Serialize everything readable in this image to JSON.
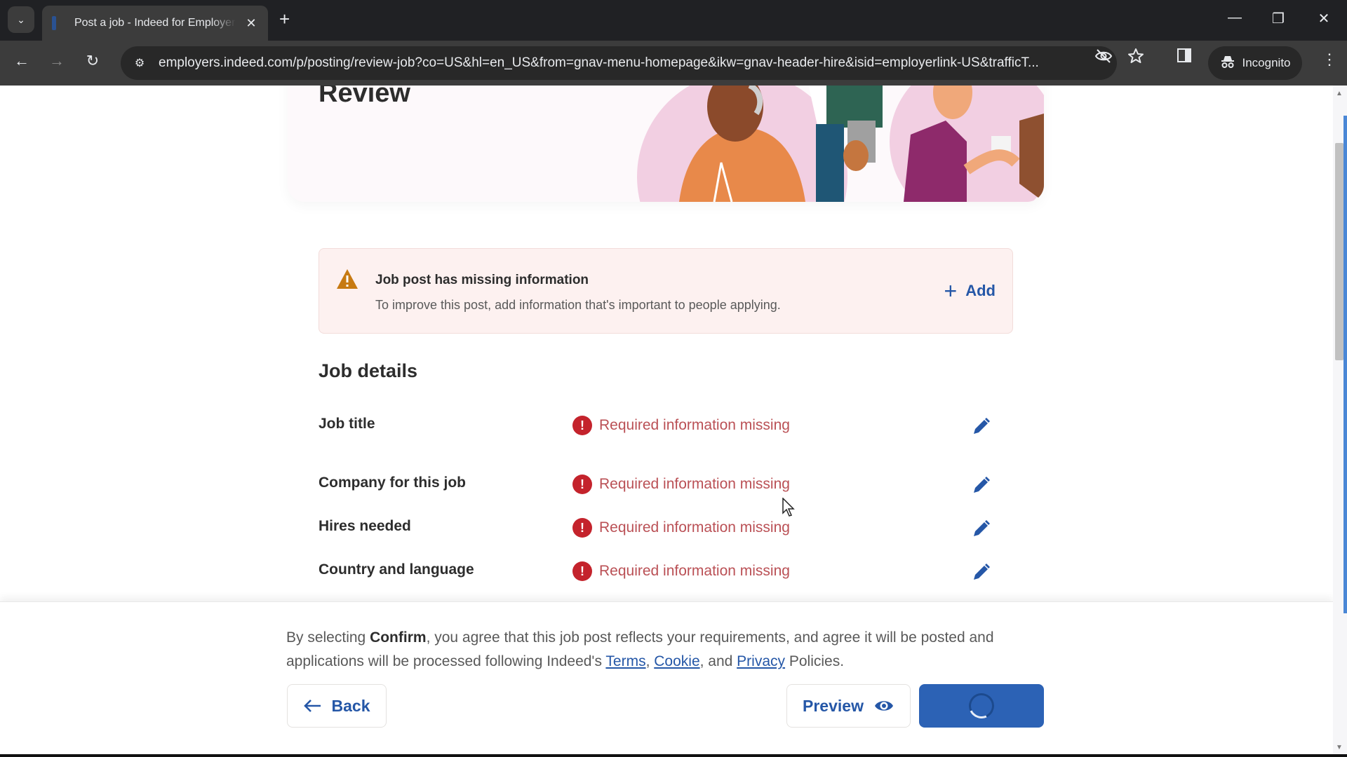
{
  "browser": {
    "tab_title": "Post a job - Indeed for Employers",
    "tab_close": "✕",
    "new_tab": "+",
    "url": "employers.indeed.com/p/posting/review-job?co=US&hl=en_US&from=gnav-menu-homepage&ikw=gnav-header-hire&isid=employerlink-US&trafficT...",
    "incognito_label": "Incognito",
    "window_controls": {
      "minimize": "—",
      "restore": "❐",
      "close": "✕"
    },
    "nav": {
      "back": "←",
      "forward": "→",
      "reload": "↻"
    }
  },
  "page": {
    "hero_title": "Review",
    "alert": {
      "title": "Job post has missing information",
      "body": "To improve this post, add information that's important to people applying.",
      "action_label": "Add",
      "action_icon": "+"
    },
    "section_title": "Job details",
    "details": [
      {
        "label": "Job title",
        "status": "Required information missing"
      },
      {
        "label": "Company for this job",
        "status": "Required information missing"
      },
      {
        "label": "Hires needed",
        "status": "Required information missing"
      },
      {
        "label": "Country and language",
        "status": "Required information missing"
      }
    ],
    "error_glyph": "!"
  },
  "footer": {
    "consent_prefix": "By selecting ",
    "consent_bold": "Confirm",
    "consent_mid": ", you agree that this job post reflects your requirements, and agree it will be posted and applications will be processed following Indeed's ",
    "link_terms": "Terms",
    "sep1": ", ",
    "link_cookie": "Cookie",
    "sep2": ", and ",
    "link_privacy": "Privacy",
    "consent_suffix": " Policies.",
    "back_label": "Back",
    "preview_label": "Preview",
    "confirm_state": "loading"
  },
  "colors": {
    "brand_blue": "#2557a7",
    "confirm_blue": "#2c62b5",
    "error_red": "#c4232c",
    "alert_bg": "#fdf1f0",
    "warning_amber": "#c77a12"
  }
}
